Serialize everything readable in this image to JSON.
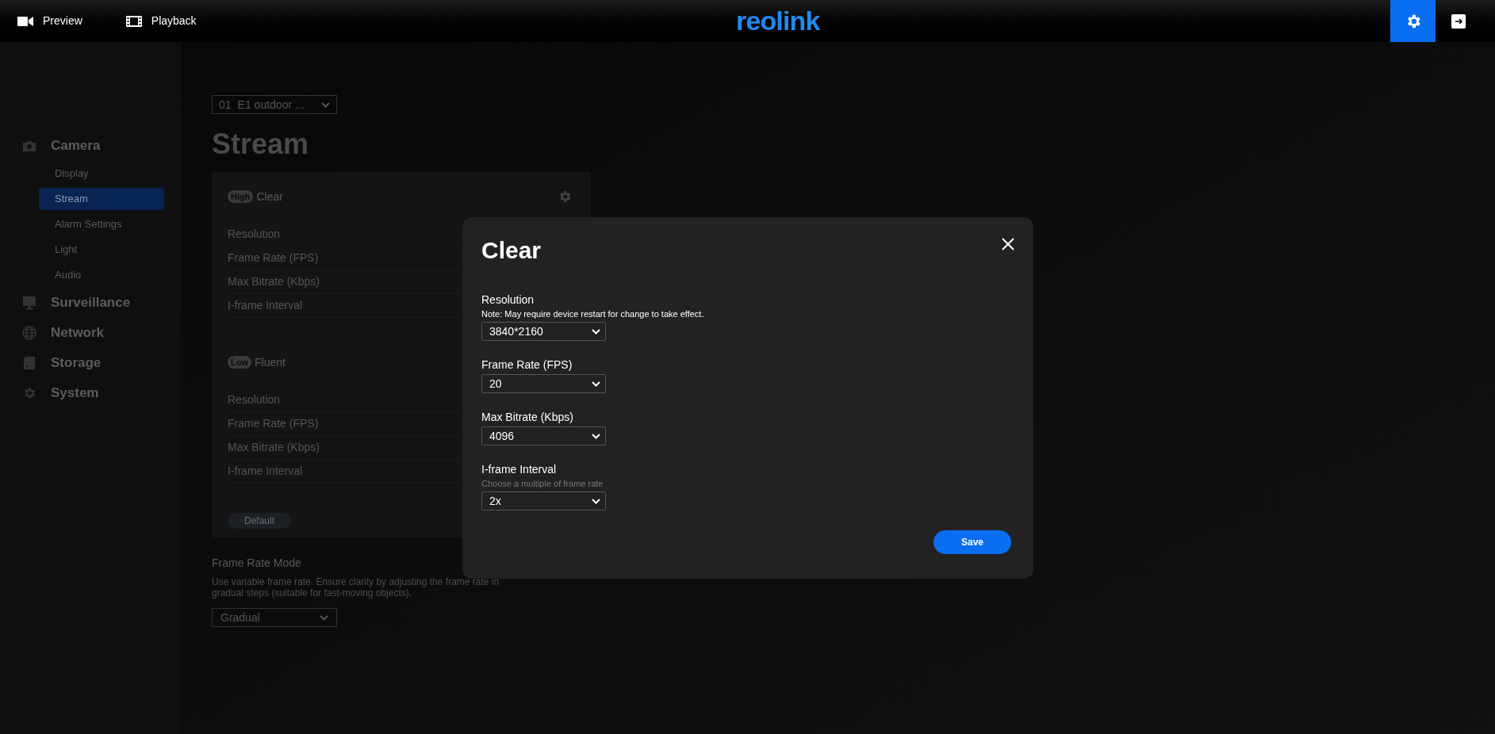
{
  "top_bar": {
    "nav": [
      {
        "label": "Preview",
        "kind": "video"
      },
      {
        "label": "Playback",
        "kind": "film"
      }
    ],
    "logo": "reolink",
    "buttons": [
      {
        "kind": "settings",
        "selected": true
      },
      {
        "kind": "logout",
        "selected": false
      }
    ]
  },
  "sidebar": {
    "groups": [
      {
        "label": "Camera",
        "kind": "camera",
        "children": [
          {
            "label": "Display",
            "selected": false
          },
          {
            "label": "Stream",
            "selected": true
          },
          {
            "label": "Alarm Settings",
            "selected": false
          },
          {
            "label": "Light",
            "selected": false
          },
          {
            "label": "Audio",
            "selected": false
          }
        ]
      },
      {
        "label": "Surveillance",
        "kind": "monitor"
      },
      {
        "label": "Network",
        "kind": "globe"
      },
      {
        "label": "Storage",
        "kind": "disk"
      },
      {
        "label": "System",
        "kind": "gear"
      }
    ]
  },
  "channel_select": {
    "number": "01",
    "value": "E1 outdoor ..."
  },
  "page_title": "Stream",
  "streams": [
    {
      "badge": "High",
      "name": "Clear",
      "rows": [
        "Resolution",
        "Frame Rate (FPS)",
        "Max Bitrate (Kbps)",
        "I-frame Interval"
      ]
    },
    {
      "badge": "Low",
      "name": "Fluent",
      "rows": [
        "Resolution",
        "Frame Rate (FPS)",
        "Max Bitrate (Kbps)",
        "I-frame Interval"
      ]
    }
  ],
  "default_button": "Default",
  "frame_rate_mode": {
    "label": "Frame Rate Mode",
    "description": "Use variable frame rate. Ensure clarity by adjusting the frame rate in gradual steps (suitable for fast-moving objects).",
    "value": "Gradual"
  },
  "dialog": {
    "title": "Clear",
    "fields": [
      {
        "label": "Resolution",
        "note": {
          "kind": "warning",
          "text": "Note: May require device restart for change to take effect."
        },
        "value": "3840*2160"
      },
      {
        "label": "Frame Rate (FPS)",
        "value": "20"
      },
      {
        "label": "Max Bitrate (Kbps)",
        "value": "4096"
      },
      {
        "label": "I-frame Interval",
        "note": {
          "kind": "help",
          "text": "Choose a multiple of frame rate"
        },
        "value": "2x"
      }
    ],
    "save": "Save"
  }
}
